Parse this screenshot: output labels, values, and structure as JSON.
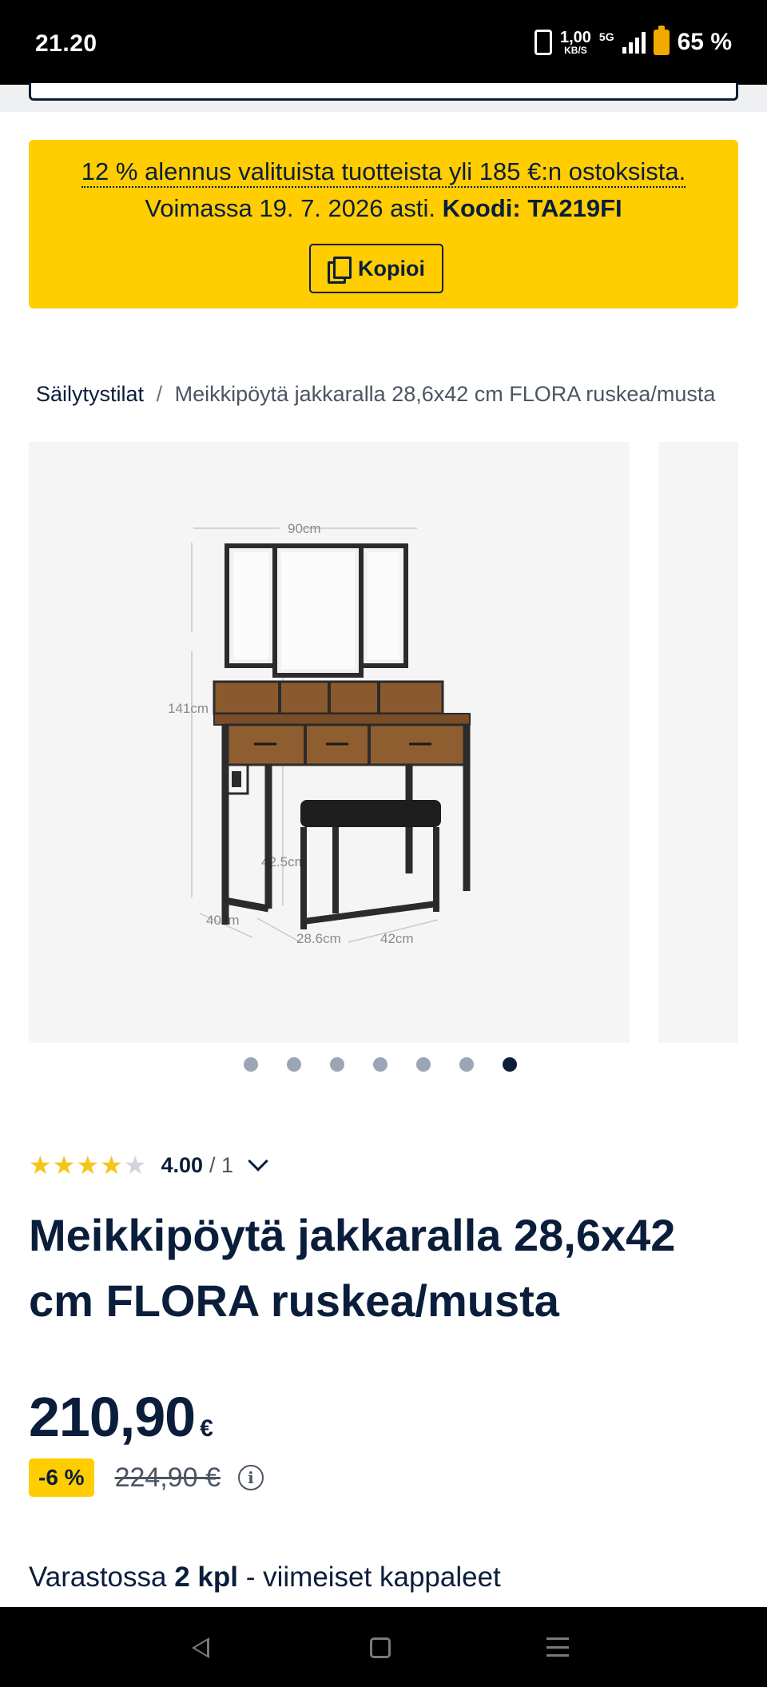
{
  "status_bar": {
    "time": "21.20",
    "speed_value": "1,00",
    "speed_unit": "KB/S",
    "network": "5G",
    "battery": "65 %"
  },
  "promo": {
    "line1": "12 % alennus valituista tuotteista yli 185 €:n ostoksista.",
    "line2_prefix": "Voimassa 19. 7. 2026 asti.",
    "code_label": "Koodi: TA219FI",
    "copy_label": "Kopioi"
  },
  "breadcrumb": {
    "link": "Säilytystilat",
    "separator": "/",
    "current": "Meikkipöytä jakkaralla 28,6x42 cm FLORA ruskea/musta"
  },
  "gallery": {
    "image_count": 7,
    "active_index": 7,
    "dimension_labels": {
      "width": "90cm",
      "height": "141cm",
      "depth": "40cm",
      "stool_height": "42.5cm",
      "stool_depth": "28.6cm",
      "stool_width": "42cm"
    }
  },
  "rating": {
    "stars_filled": 4,
    "stars_total": 5,
    "score": "4.00",
    "count": "/ 1"
  },
  "product": {
    "title": "Meikkipöytä jakkaralla 28,6x42 cm FLORA ruskea/musta",
    "price": "210,90",
    "currency": "€",
    "discount_badge": "-6 %",
    "old_price": "224,90 €",
    "info_glyph": "i"
  },
  "stock": {
    "prefix": "Varastossa",
    "amount": "2 kpl",
    "suffix": "- viimeiset kappaleet"
  }
}
